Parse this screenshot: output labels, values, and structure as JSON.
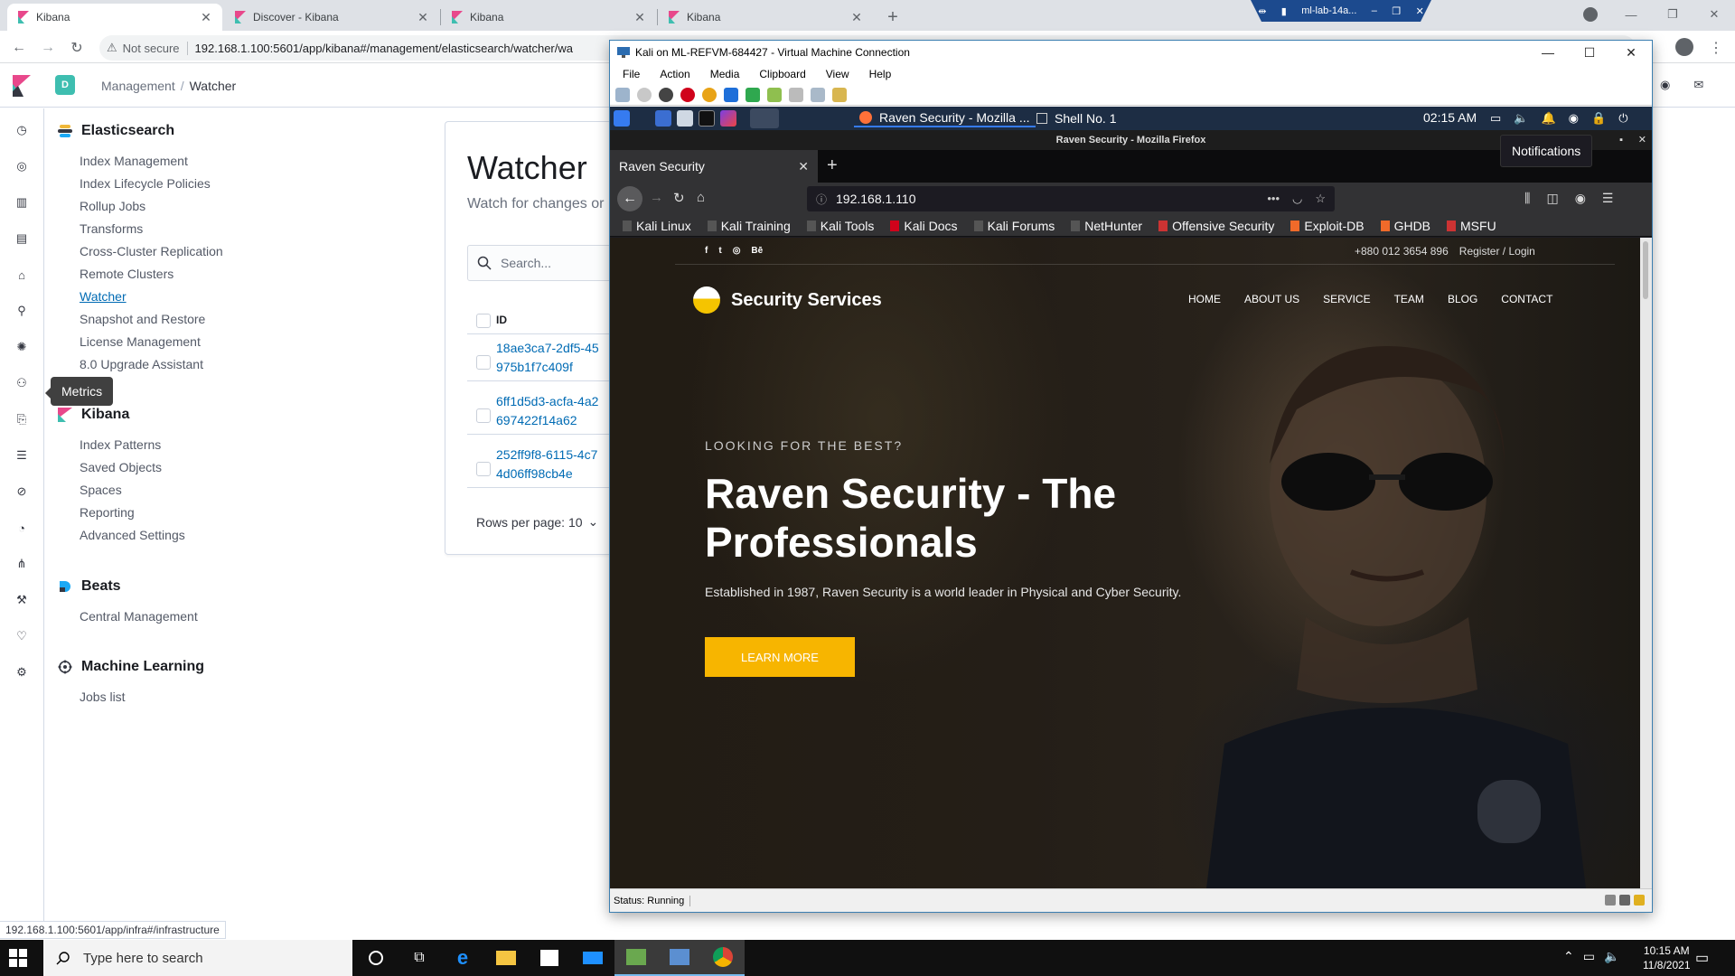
{
  "chrome": {
    "tabs": [
      {
        "title": "Kibana",
        "active": true
      },
      {
        "title": "Discover - Kibana",
        "active": false
      },
      {
        "title": "Kibana",
        "active": false
      },
      {
        "title": "Kibana",
        "active": false
      }
    ],
    "new_tab": "+",
    "security_label": "Not secure",
    "url": "192.168.1.100:5601/app/kibana#/management/elasticsearch/watcher/wa",
    "rdp_bar_label": "ml-lab-14a..."
  },
  "kibana": {
    "space_initial": "D",
    "breadcrumbs": [
      "Management",
      "Watcher"
    ],
    "nav_tooltip": "Metrics",
    "sections": [
      {
        "title": "Elasticsearch",
        "items": [
          "Index Management",
          "Index Lifecycle Policies",
          "Rollup Jobs",
          "Transforms",
          "Cross-Cluster Replication",
          "Remote Clusters",
          "Watcher",
          "Snapshot and Restore",
          "License Management",
          "8.0 Upgrade Assistant"
        ],
        "selected": "Watcher"
      },
      {
        "title": "Kibana",
        "items": [
          "Index Patterns",
          "Saved Objects",
          "Spaces",
          "Reporting",
          "Advanced Settings"
        ]
      },
      {
        "title": "Beats",
        "items": [
          "Central Management"
        ]
      },
      {
        "title": "Machine Learning",
        "items": [
          "Jobs list"
        ]
      }
    ],
    "watcher": {
      "title": "Watcher",
      "description": "Watch for changes or",
      "search_placeholder": "Search...",
      "col_id": "ID",
      "rows": [
        [
          "18ae3ca7-2df5-45",
          "975b1f7c409f"
        ],
        [
          "6ff1d5d3-acfa-4a2",
          "697422f14a62"
        ],
        [
          "252ff9f8-6115-4c7",
          "4d06ff98cb4e"
        ]
      ],
      "rows_per_page": "Rows per page: 10"
    },
    "status_url": "192.168.1.100:5601/app/infra#/infrastructure"
  },
  "vm": {
    "title": "Kali on ML-REFVM-684427 - Virtual Machine Connection",
    "menu": [
      "File",
      "Action",
      "Media",
      "Clipboard",
      "View",
      "Help"
    ],
    "status": "Status: Running",
    "kali": {
      "task_firefox": "Raven Security - Mozilla ...",
      "task_shell": "Shell No. 1",
      "clock": "02:15 AM",
      "notifications_tooltip": "Notifications",
      "firefox": {
        "window_title": "Raven Security - Mozilla Firefox",
        "tab_title": "Raven Security",
        "url": "192.168.1.110",
        "bookmarks": [
          "Kali Linux",
          "Kali Training",
          "Kali Tools",
          "Kali Docs",
          "Kali Forums",
          "NetHunter",
          "Offensive Security",
          "Exploit-DB",
          "GHDB",
          "MSFU"
        ]
      },
      "site": {
        "phone": "+880 012 3654 896",
        "register": "Register / Login",
        "social": [
          "f",
          "t",
          "◎",
          "Bē"
        ],
        "brand": "Security Services",
        "menu": [
          "HOME",
          "ABOUT US",
          "SERVICE",
          "TEAM",
          "BLOG",
          "CONTACT"
        ],
        "eyebrow": "LOOKING FOR THE BEST?",
        "headline": "Raven Security - The Professionals",
        "subtext": "Established in 1987, Raven Security is a world leader in Physical and Cyber Security.",
        "cta": "LEARN MORE"
      }
    }
  },
  "taskbar": {
    "search_placeholder": "Type here to search",
    "time": "10:15 AM",
    "date": "11/8/2021"
  },
  "colors": {
    "kibana_link": "#006bb4",
    "cta_yellow": "#f7b500",
    "space_avatar": "#3ebeb0"
  }
}
